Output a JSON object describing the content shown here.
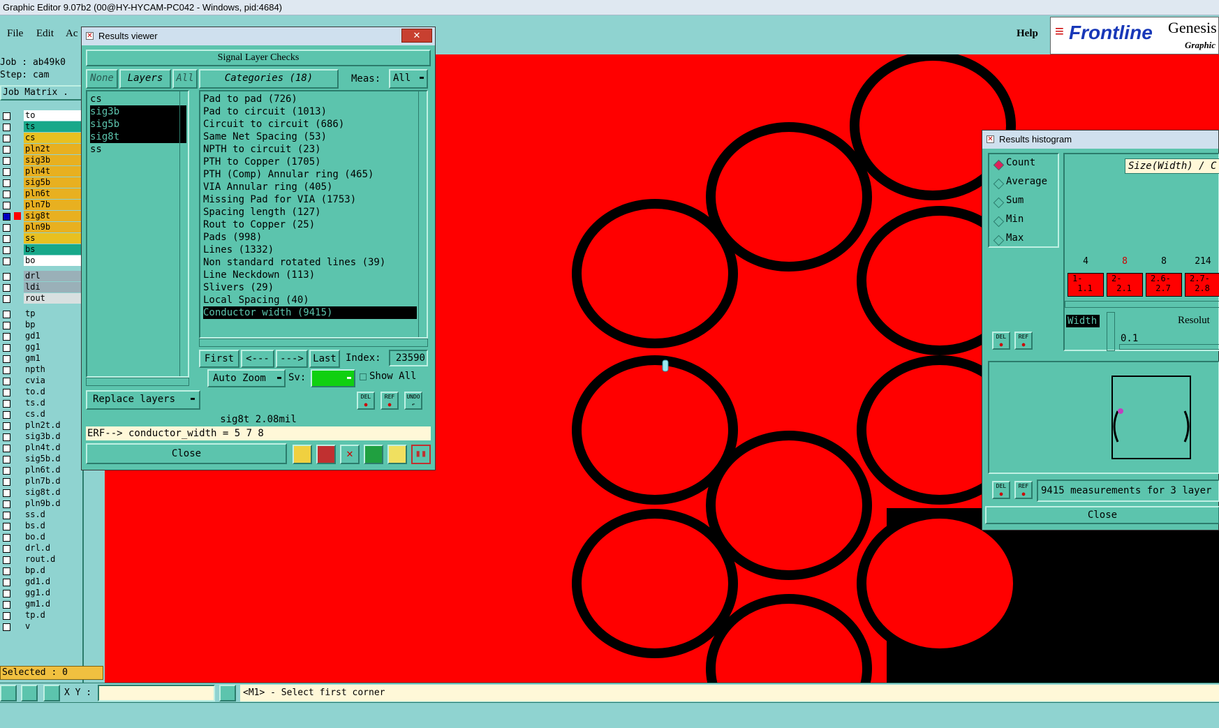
{
  "window_title": "Graphic Editor 9.07b2 (00@HY-HYCAM-PC042 - Windows, pid:4684)",
  "menu": {
    "file": "File",
    "edit": "Edit",
    "actions": "Ac",
    "help": "Help"
  },
  "logo": {
    "brand": "Frontline",
    "product": "Genesis",
    "sub": "Graphic"
  },
  "job_info": {
    "job": "Job : ab49k0",
    "step": "Step: cam"
  },
  "job_matrix_label": "Job Matrix .",
  "layers": [
    {
      "name": "to",
      "color": "#ffffff"
    },
    {
      "name": "ts",
      "color": "#18a88a"
    },
    {
      "name": "cs",
      "color": "#e8c020"
    },
    {
      "name": "pln2t",
      "color": "#e8b020"
    },
    {
      "name": "sig3b",
      "color": "#e8b020"
    },
    {
      "name": "pln4t",
      "color": "#e8b020"
    },
    {
      "name": "sig5b",
      "color": "#e8b020"
    },
    {
      "name": "pln6t",
      "color": "#e8b020"
    },
    {
      "name": "pln7b",
      "color": "#e8b020"
    },
    {
      "name": "sig8t",
      "color": "#e8b020"
    },
    {
      "name": "pln9b",
      "color": "#e8b020"
    },
    {
      "name": "ss",
      "color": "#e8c020"
    },
    {
      "name": "bs",
      "color": "#18a88a"
    },
    {
      "name": "bo",
      "color": "#ffffff"
    },
    {
      "name": "drl",
      "color": "#9ab0b8"
    },
    {
      "name": "ldi",
      "color": "#9ab0b8"
    },
    {
      "name": "rout",
      "color": "#d8e0e0"
    },
    {
      "name": "tp",
      "color": "#8fd3d0"
    },
    {
      "name": "bp",
      "color": "#8fd3d0"
    },
    {
      "name": "gd1",
      "color": "#8fd3d0"
    },
    {
      "name": "gg1",
      "color": "#8fd3d0"
    },
    {
      "name": "gm1",
      "color": "#8fd3d0"
    },
    {
      "name": "npth",
      "color": "#8fd3d0"
    },
    {
      "name": "cvia",
      "color": "#8fd3d0"
    },
    {
      "name": "to.d",
      "color": "#8fd3d0"
    },
    {
      "name": "ts.d",
      "color": "#8fd3d0"
    },
    {
      "name": "cs.d",
      "color": "#8fd3d0"
    },
    {
      "name": "pln2t.d",
      "color": "#8fd3d0"
    },
    {
      "name": "sig3b.d",
      "color": "#8fd3d0"
    },
    {
      "name": "pln4t.d",
      "color": "#8fd3d0"
    },
    {
      "name": "sig5b.d",
      "color": "#8fd3d0"
    },
    {
      "name": "pln6t.d",
      "color": "#8fd3d0"
    },
    {
      "name": "pln7b.d",
      "color": "#8fd3d0"
    },
    {
      "name": "sig8t.d",
      "color": "#8fd3d0"
    },
    {
      "name": "pln9b.d",
      "color": "#8fd3d0"
    },
    {
      "name": "ss.d",
      "color": "#8fd3d0"
    },
    {
      "name": "bs.d",
      "color": "#8fd3d0"
    },
    {
      "name": "bo.d",
      "color": "#8fd3d0"
    },
    {
      "name": "drl.d",
      "color": "#8fd3d0"
    },
    {
      "name": "rout.d",
      "color": "#8fd3d0"
    },
    {
      "name": "bp.d",
      "color": "#8fd3d0"
    },
    {
      "name": "gd1.d",
      "color": "#8fd3d0"
    },
    {
      "name": "gg1.d",
      "color": "#8fd3d0"
    },
    {
      "name": "gm1.d",
      "color": "#8fd3d0"
    },
    {
      "name": "tp.d",
      "color": "#8fd3d0"
    },
    {
      "name": "v",
      "color": "#8fd3d0"
    }
  ],
  "selected_label": "Selected : 0",
  "results_viewer": {
    "title": "Results viewer",
    "header": "Signal Layer Checks",
    "none_btn": "None",
    "layers_btn": "Layers",
    "all_btn": "All",
    "categories_btn": "Categories (18)",
    "meas_label": "Meas:",
    "meas_value": "All",
    "layer_list": [
      {
        "name": "cs",
        "selected": false
      },
      {
        "name": "sig3b",
        "selected": true
      },
      {
        "name": "sig5b",
        "selected": true
      },
      {
        "name": "sig8t",
        "selected": true
      },
      {
        "name": "ss",
        "selected": false
      }
    ],
    "categories": [
      {
        "label": "Pad to pad (726)",
        "selected": false
      },
      {
        "label": "Pad to circuit (1013)",
        "selected": false
      },
      {
        "label": "Circuit to circuit (686)",
        "selected": false
      },
      {
        "label": "Same Net Spacing (53)",
        "selected": false
      },
      {
        "label": "NPTH to circuit (23)",
        "selected": false
      },
      {
        "label": "PTH to Copper (1705)",
        "selected": false
      },
      {
        "label": "PTH (Comp) Annular ring (465)",
        "selected": false
      },
      {
        "label": "VIA Annular ring (405)",
        "selected": false
      },
      {
        "label": "Missing Pad for VIA (1753)",
        "selected": false
      },
      {
        "label": "Spacing length (127)",
        "selected": false
      },
      {
        "label": "Rout to Copper (25)",
        "selected": false
      },
      {
        "label": "Pads (998)",
        "selected": false
      },
      {
        "label": "Lines (1332)",
        "selected": false
      },
      {
        "label": "Non standard rotated lines (39)",
        "selected": false
      },
      {
        "label": "Line Neckdown (113)",
        "selected": false
      },
      {
        "label": "Slivers (29)",
        "selected": false
      },
      {
        "label": "Local Spacing (40)",
        "selected": false
      },
      {
        "label": "Conductor width (9415)",
        "selected": true
      }
    ],
    "first_btn": "First",
    "prev_btn": "<---",
    "next_btn": "--->",
    "last_btn": "Last",
    "index_label": "Index:",
    "index_value": "23590",
    "replace_layers": "Replace layers",
    "auto_zoom": "Auto Zoom",
    "sv_label": "Sv:",
    "show_all": "Show All",
    "del": "DEL",
    "ref": "REF",
    "undo": "UNDO",
    "status": "sig8t 2.08mil",
    "erf": "ERF--> conductor_width = 5 7 8",
    "close": "Close"
  },
  "histogram": {
    "title": "Results histogram",
    "options": [
      {
        "label": "Count",
        "selected": true
      },
      {
        "label": "Average",
        "selected": false
      },
      {
        "label": "Sum",
        "selected": false
      },
      {
        "label": "Min",
        "selected": false
      },
      {
        "label": "Max",
        "selected": false
      }
    ],
    "axis_title": "Size(Width) / C",
    "bars": [
      {
        "count": "4",
        "count_color": "#000000",
        "label": "1-\n 1.1"
      },
      {
        "count": "8",
        "count_color": "#cc0000",
        "label": "2-\n 2.1"
      },
      {
        "count": "8",
        "count_color": "#000000",
        "label": "2.6-\n 2.7"
      },
      {
        "count": "214",
        "count_color": "#000000",
        "label": "2.7-\n 2.8"
      }
    ],
    "width_label": "Width",
    "resolution_label": "Resolut",
    "resolution_value": "0.1",
    "del": "DEL",
    "ref": "REF",
    "summary": "9415 measurements for 3 layer",
    "close": "Close"
  },
  "bottom": {
    "xy_label": "X Y :",
    "xy_value": "",
    "prompt": "<M1> - Select first corner"
  }
}
